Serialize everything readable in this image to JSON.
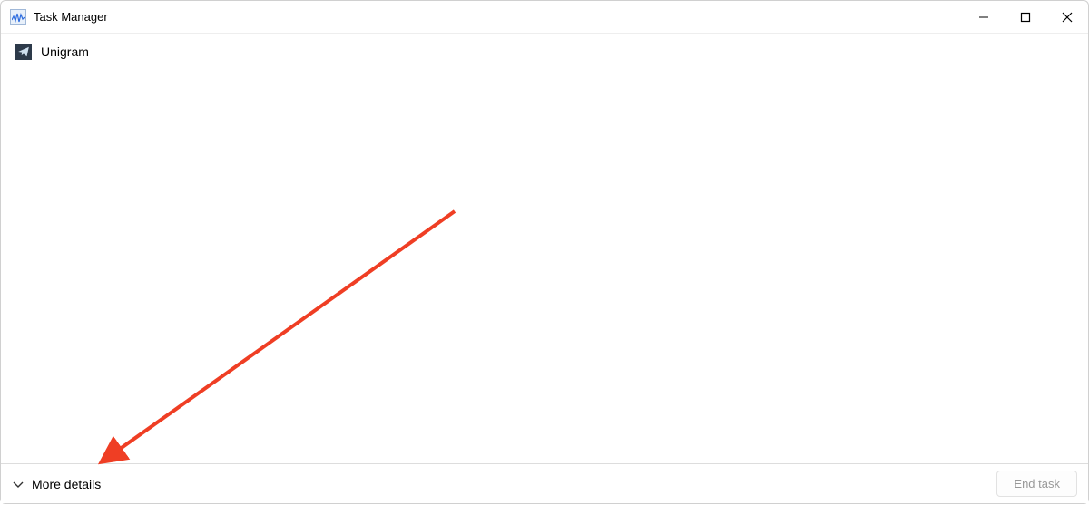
{
  "window": {
    "title": "Task Manager"
  },
  "processes": [
    {
      "name": "Unigram",
      "icon": "telegram-icon"
    }
  ],
  "footer": {
    "more_details_prefix": "More ",
    "more_details_underlined": "d",
    "more_details_suffix": "etails",
    "end_task_label": "End task"
  },
  "annotation": {
    "color": "#ef3e24"
  }
}
